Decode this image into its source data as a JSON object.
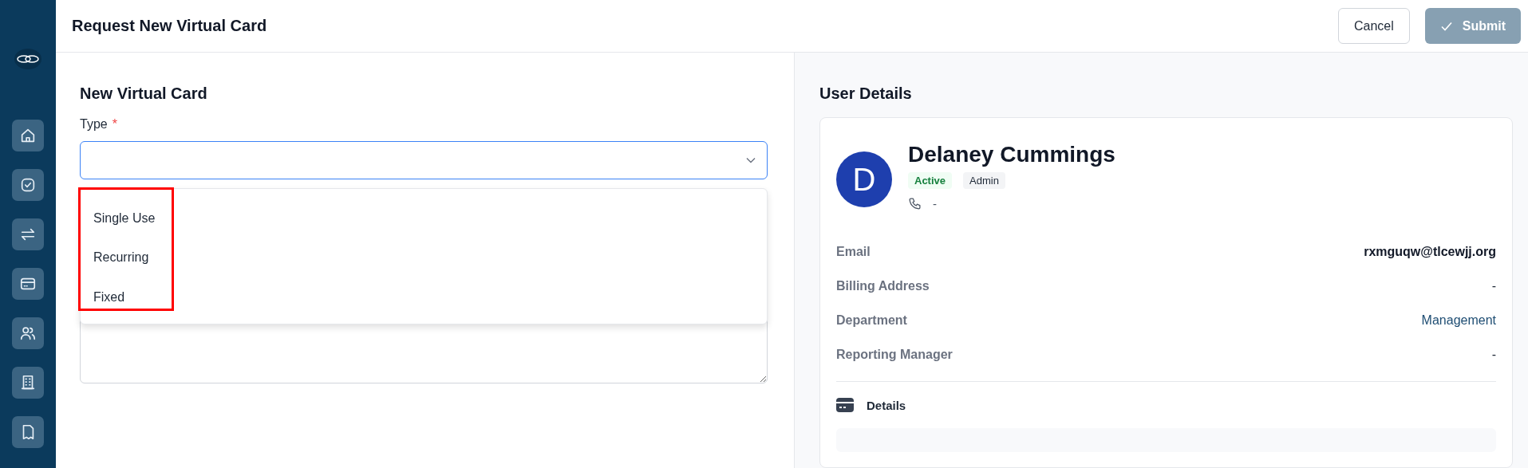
{
  "header": {
    "title": "Request New Virtual Card",
    "buttons": [
      {
        "label": "Cancel",
        "kind": "secondary",
        "disabled": false
      },
      {
        "label": "Submit",
        "kind": "primary",
        "disabled": true
      }
    ]
  },
  "form": {
    "title": "New Virtual Card",
    "type_field": {
      "label": "Type",
      "required_mark": "*",
      "focused": true,
      "expanded": true
    },
    "dropdown": {
      "options": [
        {
          "label": "Single Use",
          "selected": false
        },
        {
          "label": "Recurring",
          "selected": false
        },
        {
          "label": "Fixed",
          "selected": false
        }
      ]
    }
  },
  "user": {
    "title": "User Details",
    "avatar_initial": "D",
    "name": "Delaney Cummings",
    "badges": [
      {
        "label": "Active",
        "kind": "status"
      },
      {
        "label": "Admin",
        "kind": "role"
      }
    ],
    "phone": "-",
    "fields": [
      {
        "label": "Email",
        "value": "rxmguqw@tlcewjj.org",
        "kind": "emphasis"
      },
      {
        "label": "Billing Address",
        "value": "-",
        "kind": "plain"
      },
      {
        "label": "Department",
        "value": "Management",
        "kind": "link"
      },
      {
        "label": "Reporting Manager",
        "value": "-",
        "kind": "plain"
      }
    ],
    "details_title": "Details"
  }
}
